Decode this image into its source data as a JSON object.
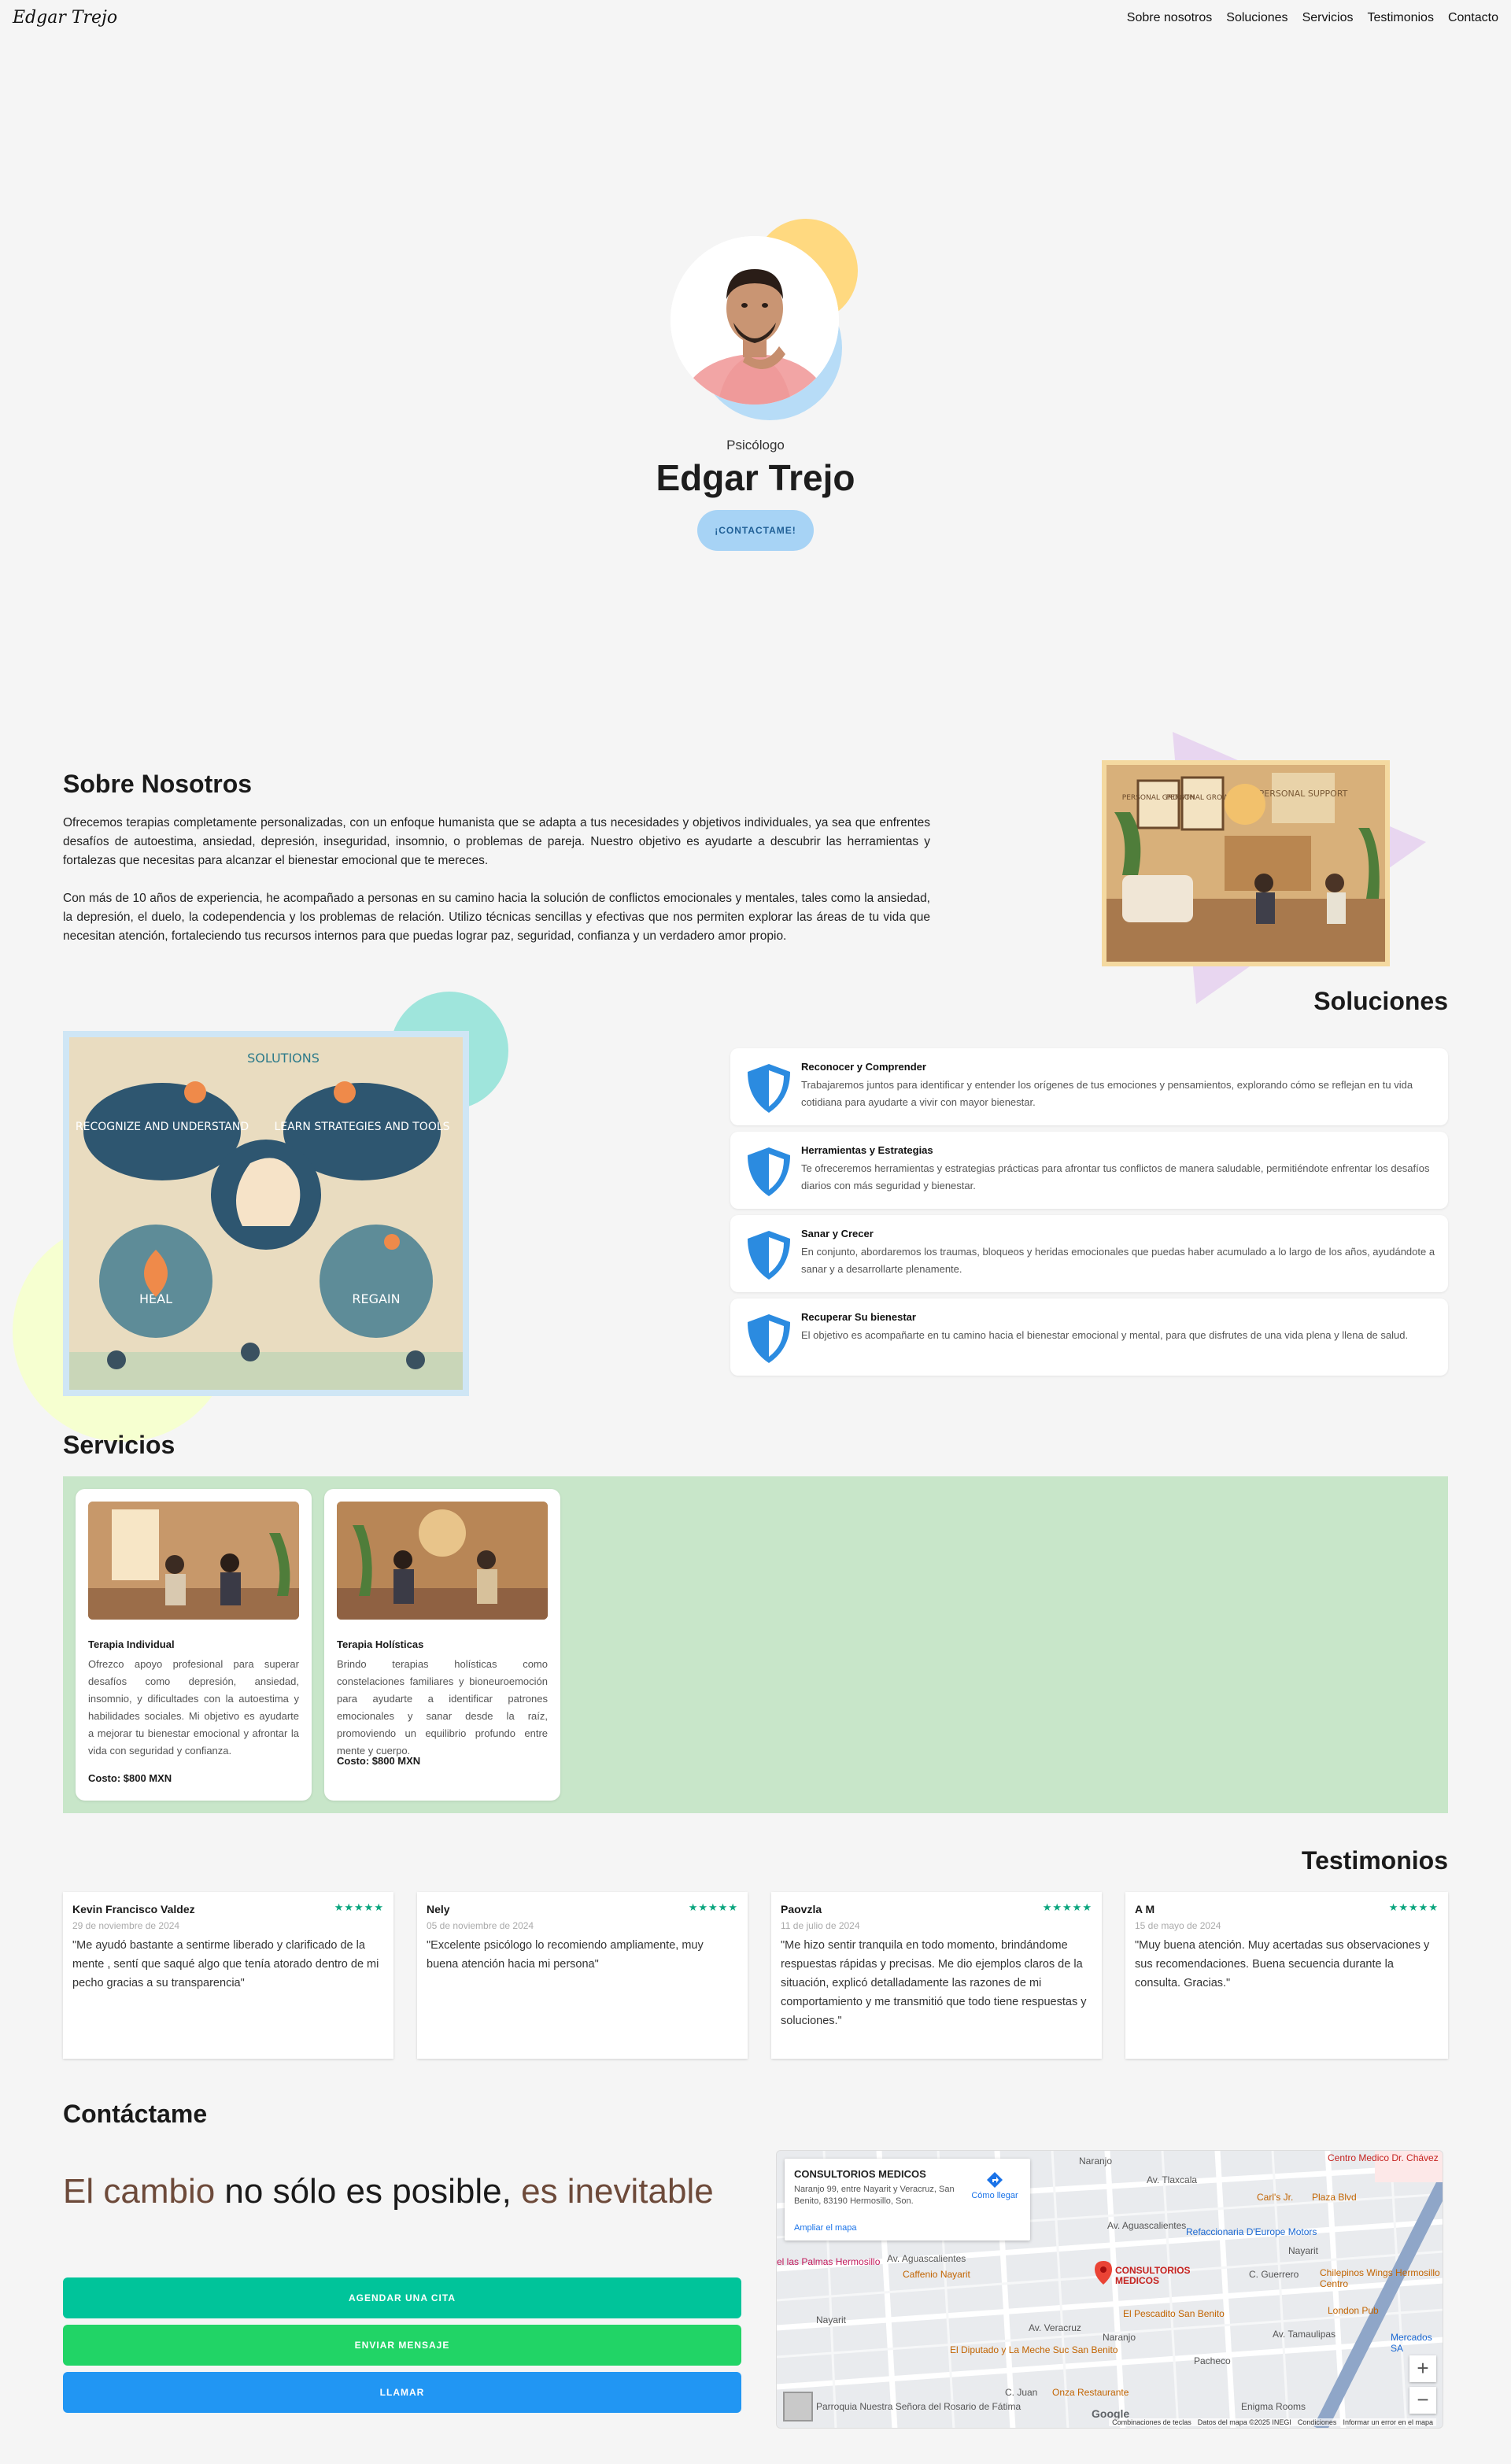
{
  "nav": {
    "logo": "Edgar Trejo",
    "items": [
      "Sobre nosotros",
      "Soluciones",
      "Servicios",
      "Testimonios",
      "Contacto"
    ]
  },
  "hero": {
    "subtitle": "Psicólogo",
    "name": "Edgar Trejo",
    "button": "¡CONTACTAME!"
  },
  "about": {
    "title": "Sobre Nosotros",
    "p1": "Ofrecemos terapias completamente personalizadas, con un enfoque humanista que se adapta a tus necesidades y objetivos individuales, ya sea que enfrentes desafíos de autoestima, ansiedad, depresión, inseguridad, insomnio, o problemas de pareja. Nuestro objetivo es ayudarte a descubrir las herramientas y fortalezas que necesitas para alcanzar el bienestar emocional que te mereces.",
    "p2": "Con más de 10 años de experiencia, he acompañado a personas en su camino hacia la solución de conflictos emocionales y mentales, tales como la ansiedad, la depresión, el duelo, la codependencia y los problemas de relación. Utilizo técnicas sencillas y efectivas que nos permiten explorar las áreas de tu vida que necesitan atención, fortaleciendo tus recursos internos para que puedas lograr paz, seguridad, confianza y un verdadero amor propio.",
    "image_signs": [
      "PERSONAL GROWTH",
      "PERSONAL GROWTH",
      "PERSONAL SUPPORT"
    ]
  },
  "solutions": {
    "title": "Soluciones",
    "image_texts": [
      "SOLUTIONS",
      "RECOGNIZE AND UNDERSTAND",
      "LEARN STRATEGIES AND TOOLS",
      "HEAL",
      "REGAIN"
    ],
    "items": [
      {
        "title": "Reconocer y Comprender",
        "desc": "Trabajaremos juntos para identificar y entender los orígenes de tus emociones y pensamientos, explorando cómo se reflejan en tu vida cotidiana para ayudarte a vivir con mayor bienestar."
      },
      {
        "title": "Herramientas y Estrategias",
        "desc": "Te ofreceremos herramientas y estrategias prácticas para afrontar tus conflictos de manera saludable, permitiéndote enfrentar los desafíos diarios con más seguridad y bienestar."
      },
      {
        "title": "Sanar y Crecer",
        "desc": "En conjunto, abordaremos los traumas, bloqueos y heridas emocionales que puedas haber acumulado a lo largo de los años, ayudándote a sanar y a desarrollarte plenamente."
      },
      {
        "title": "Recuperar Su bienestar",
        "desc": "El objetivo es acompañarte en tu camino hacia el bienestar emocional y mental, para que disfrutes de una vida plena y llena de salud."
      }
    ]
  },
  "services": {
    "title": "Servicios",
    "items": [
      {
        "title": "Terapia Individual",
        "desc": "Ofrezco apoyo profesional para superar desafíos como depresión, ansiedad, insomnio, y dificultades con la autoestima y habilidades sociales. Mi objetivo es ayudarte a mejorar tu bienestar emocional y afrontar la vida con seguridad y confianza.",
        "cost": "Costo: $800 MXN"
      },
      {
        "title": "Terapia Holísticas",
        "desc": "Brindo terapias holísticas como constelaciones familiares y bioneuroemoción para ayudarte a identificar patrones emocionales y sanar desde la raíz, promoviendo un equilibrio profundo entre mente y cuerpo.",
        "cost": "Costo: $800 MXN"
      }
    ]
  },
  "testimonials": {
    "title": "Testimonios",
    "stars": "★★★★★",
    "items": [
      {
        "name": "Kevin Francisco Valdez",
        "date": "29 de noviembre de 2024",
        "text": "\"Me ayudó bastante a sentirme liberado y clarificado de la mente , sentí que saqué algo que tenía atorado dentro de mi pecho gracias a su transparencia\""
      },
      {
        "name": "Nely",
        "date": "05 de noviembre de 2024",
        "text": "\"Excelente psicólogo lo recomiendo ampliamente, muy buena atención hacia mi persona\""
      },
      {
        "name": "Paovzla",
        "date": "11 de julio de 2024",
        "text": "\"Me hizo sentir tranquila en todo momento, brindándome respuestas rápidas y precisas. Me dio ejemplos claros de la situación, explicó detalladamente las razones de mi comportamiento y me transmitió que todo tiene respuestas y soluciones.\""
      },
      {
        "name": "A M",
        "date": "15 de mayo de 2024",
        "text": "\"Muy buena atención. Muy acertadas sus observaciones y sus recomendaciones. Buena secuencia durante la consulta. Gracias.\""
      }
    ]
  },
  "contact": {
    "title": "Contáctame",
    "tag1": "El cambio",
    "tag2": " no sólo es posible, ",
    "tag3": "es inevitable",
    "btn_appointment": "AGENDAR UNA CITA",
    "btn_message": "ENVIAR MENSAJE",
    "btn_call": "LLAMAR",
    "colors": {
      "appointment": "#00c49a",
      "message": "#21d466",
      "call": "#2196f3"
    }
  },
  "map": {
    "place": "CONSULTORIOS MEDICOS",
    "address": "Naranjo 99, entre Nayarit y Veracruz, San Benito, 83190 Hermosillo, Son.",
    "directions": "Cómo llegar",
    "enlarge": "Ampliar el mapa",
    "pin_label": "CONSULTORIOS MEDICOS",
    "streets": [
      "Av. Tlaxcala",
      "Av. Aguascalientes",
      "Av. Aguascalientes",
      "Nayarit",
      "Nayarit",
      "Av. Veracruz",
      "Av. Tamaulipas",
      "Naranjo",
      "Naranjo",
      "C. Guerrero",
      "Pacheco",
      "C. Juan"
    ],
    "pois": [
      "Centro Medico Dr. Chávez",
      "Carl's Jr.",
      "Plaza Blvd",
      "Refaccionaria D'Europe Motors",
      "Chilepinos Wings Hermosillo Centro",
      "London Pub",
      "Mercados SA",
      "El Pescadito San Benito",
      "Caffenio Nayarit",
      "el las Palmas Hermosillo",
      "El Diputado y La Meche Suc San Benito",
      "Onza Restaurante",
      "Enigma Rooms",
      "Parroquia Nuestra Señora del Rosario de Fátima"
    ],
    "zoom_in": "+",
    "zoom_out": "−",
    "footer": [
      "Combinaciones de teclas",
      "Datos del mapa ©2025 INEGI",
      "Condiciones",
      "Informar un error en el mapa"
    ],
    "google": "Google"
  }
}
